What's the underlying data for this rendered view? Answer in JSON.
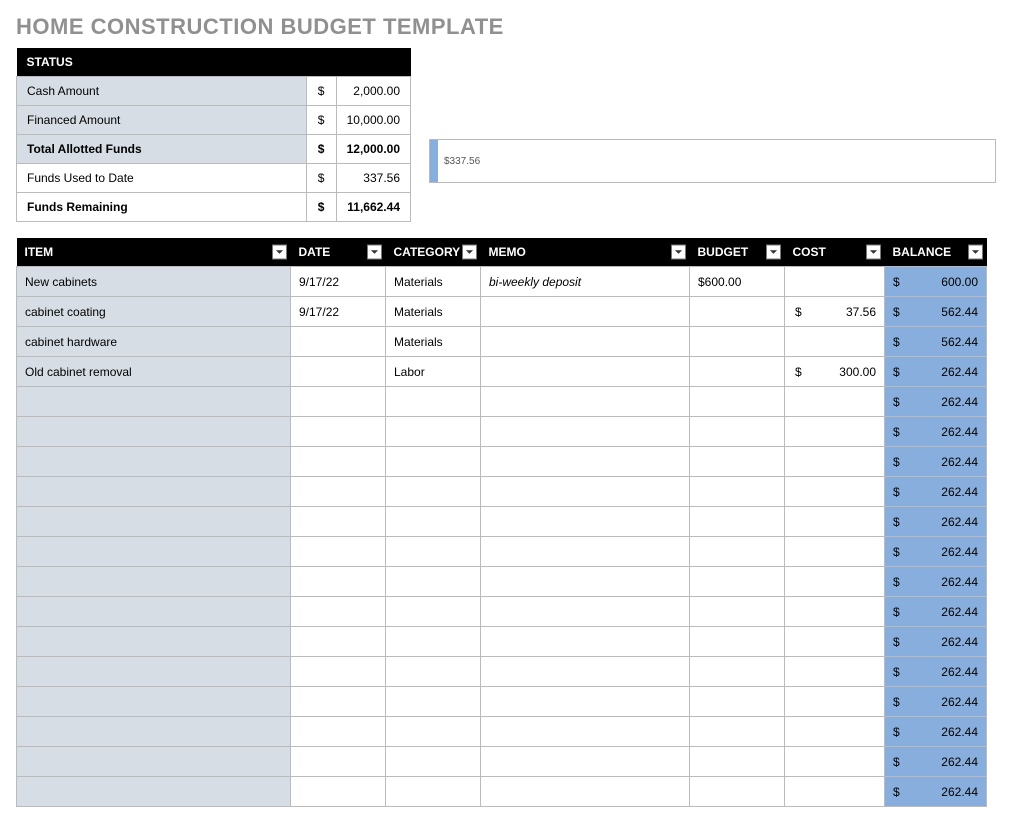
{
  "title": "HOME CONSTRUCTION BUDGET TEMPLATE",
  "status": {
    "header": "STATUS",
    "rows": [
      {
        "label": "Cash Amount",
        "value": "2,000.00",
        "bold": false,
        "shaded": true
      },
      {
        "label": "Financed Amount",
        "value": "10,000.00",
        "bold": false,
        "shaded": true
      },
      {
        "label": "Total Allotted Funds",
        "value": "12,000.00",
        "bold": true,
        "shaded": true
      },
      {
        "label": "Funds Used to Date",
        "value": "337.56",
        "bold": false,
        "shaded": false
      },
      {
        "label": "Funds Remaining",
        "value": "11,662.44",
        "bold": true,
        "shaded": false
      }
    ]
  },
  "progress": {
    "label": "$337.56"
  },
  "columns": {
    "item": "ITEM",
    "date": "DATE",
    "category": "CATEGORY",
    "memo": "MEMO",
    "budget": "BUDGET",
    "cost": "COST",
    "balance": "BALANCE"
  },
  "rows": [
    {
      "item": "New cabinets",
      "date": "9/17/22",
      "category": "Materials",
      "memo": "bi-weekly deposit",
      "budget": "$600.00",
      "cost": "",
      "balance": "600.00"
    },
    {
      "item": "cabinet coating",
      "date": "9/17/22",
      "category": "Materials",
      "memo": "",
      "budget": "",
      "cost": "37.56",
      "balance": "562.44"
    },
    {
      "item": "cabinet hardware",
      "date": "",
      "category": "Materials",
      "memo": "",
      "budget": "",
      "cost": "",
      "balance": "562.44"
    },
    {
      "item": "Old cabinet removal",
      "date": "",
      "category": "Labor",
      "memo": "",
      "budget": "",
      "cost": "300.00",
      "balance": "262.44"
    },
    {
      "item": "",
      "date": "",
      "category": "",
      "memo": "",
      "budget": "",
      "cost": "",
      "balance": "262.44"
    },
    {
      "item": "",
      "date": "",
      "category": "",
      "memo": "",
      "budget": "",
      "cost": "",
      "balance": "262.44"
    },
    {
      "item": "",
      "date": "",
      "category": "",
      "memo": "",
      "budget": "",
      "cost": "",
      "balance": "262.44"
    },
    {
      "item": "",
      "date": "",
      "category": "",
      "memo": "",
      "budget": "",
      "cost": "",
      "balance": "262.44"
    },
    {
      "item": "",
      "date": "",
      "category": "",
      "memo": "",
      "budget": "",
      "cost": "",
      "balance": "262.44"
    },
    {
      "item": "",
      "date": "",
      "category": "",
      "memo": "",
      "budget": "",
      "cost": "",
      "balance": "262.44"
    },
    {
      "item": "",
      "date": "",
      "category": "",
      "memo": "",
      "budget": "",
      "cost": "",
      "balance": "262.44"
    },
    {
      "item": "",
      "date": "",
      "category": "",
      "memo": "",
      "budget": "",
      "cost": "",
      "balance": "262.44"
    },
    {
      "item": "",
      "date": "",
      "category": "",
      "memo": "",
      "budget": "",
      "cost": "",
      "balance": "262.44"
    },
    {
      "item": "",
      "date": "",
      "category": "",
      "memo": "",
      "budget": "",
      "cost": "",
      "balance": "262.44"
    },
    {
      "item": "",
      "date": "",
      "category": "",
      "memo": "",
      "budget": "",
      "cost": "",
      "balance": "262.44"
    },
    {
      "item": "",
      "date": "",
      "category": "",
      "memo": "",
      "budget": "",
      "cost": "",
      "balance": "262.44"
    },
    {
      "item": "",
      "date": "",
      "category": "",
      "memo": "",
      "budget": "",
      "cost": "",
      "balance": "262.44"
    },
    {
      "item": "",
      "date": "",
      "category": "",
      "memo": "",
      "budget": "",
      "cost": "",
      "balance": "262.44"
    }
  ]
}
